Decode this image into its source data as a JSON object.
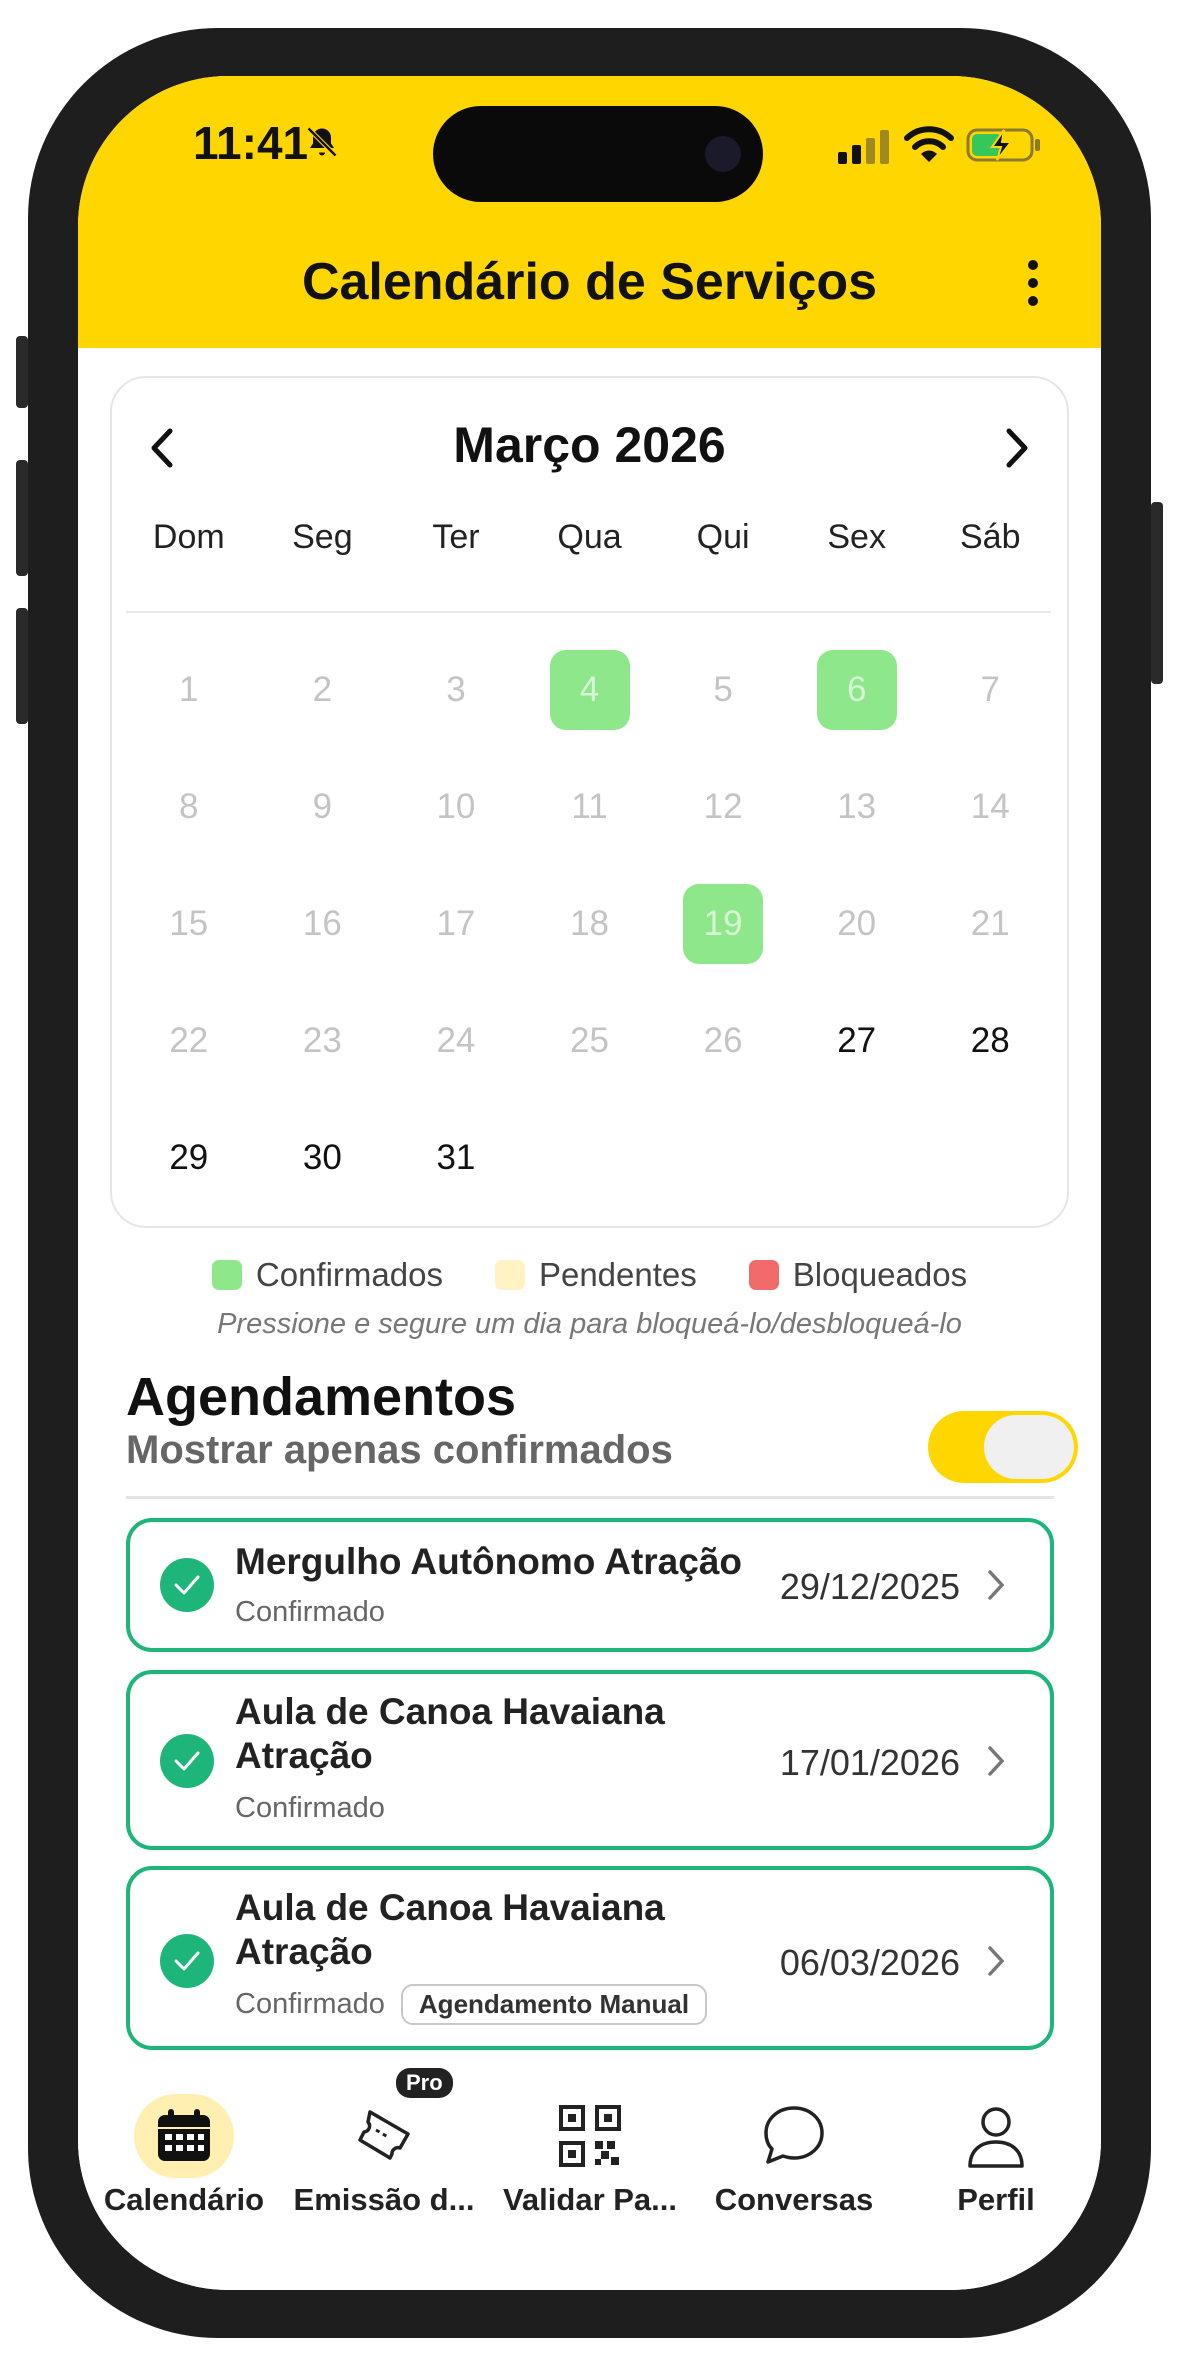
{
  "status_bar": {
    "time": "11:41"
  },
  "header": {
    "title": "Calendário de Serviços"
  },
  "calendar": {
    "month_label": "Março 2026",
    "weekdays": [
      "Dom",
      "Seg",
      "Ter",
      "Qua",
      "Qui",
      "Sex",
      "Sáb"
    ],
    "weeks": [
      [
        "1",
        "2",
        "3",
        "4",
        "5",
        "6",
        "7"
      ],
      [
        "8",
        "9",
        "10",
        "11",
        "12",
        "13",
        "14"
      ],
      [
        "15",
        "16",
        "17",
        "18",
        "19",
        "20",
        "21"
      ],
      [
        "22",
        "23",
        "24",
        "25",
        "26",
        "27",
        "28"
      ],
      [
        "29",
        "30",
        "31",
        "",
        "",
        "",
        ""
      ]
    ],
    "confirmed_days": [
      "4",
      "6",
      "19"
    ],
    "past_through_day": 26,
    "colors": {
      "confirmed": "#8EE88B",
      "pending": "#FFF3C4",
      "blocked": "#F26B6B"
    }
  },
  "legend": {
    "confirmed": "Confirmados",
    "pending": "Pendentes",
    "blocked": "Bloqueados",
    "hint": "Pressione e segure um dia para bloqueá-lo/desbloqueá-lo"
  },
  "appointments_section": {
    "title": "Agendamentos",
    "filter_label": "Mostrar apenas confirmados"
  },
  "appointments": [
    {
      "title_line1": "Mergulho Autônomo Atração",
      "title_line2": "",
      "status": "Confirmado",
      "date": "29/12/2025",
      "tag": ""
    },
    {
      "title_line1": "Aula de Canoa Havaiana",
      "title_line2": "Atração",
      "status": "Confirmado",
      "date": "17/01/2026",
      "tag": ""
    },
    {
      "title_line1": "Aula de Canoa Havaiana",
      "title_line2": "Atração",
      "status": "Confirmado",
      "date": "06/03/2026",
      "tag": "Agendamento Manual"
    }
  ],
  "tabbar": {
    "calendar": "Calendário",
    "emission": "Emissão d...",
    "validate": "Validar Pa...",
    "chats": "Conversas",
    "profile": "Perfil",
    "pro_badge": "Pro"
  },
  "theme": {
    "accent": "#FFD600",
    "success": "#1DB57A"
  }
}
